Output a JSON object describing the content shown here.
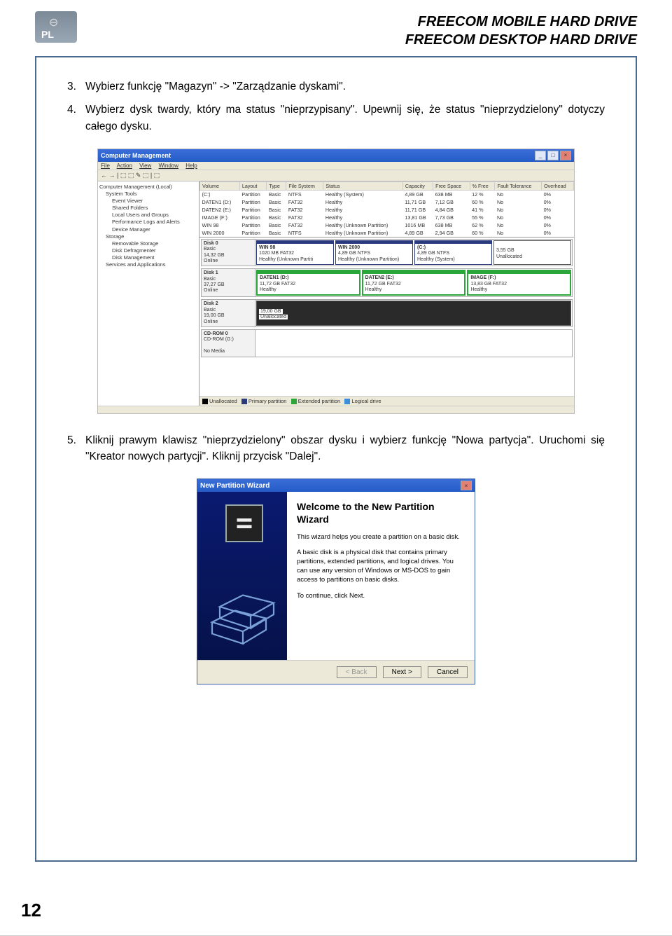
{
  "pl_badge": "PL",
  "header": {
    "line1": "FREECOM MOBILE HARD DRIVE",
    "line2": "FREECOM DESKTOP HARD DRIVE"
  },
  "steps": {
    "s3_num": "3.",
    "s3": "Wybierz funkcję \"Magazyn\" -> \"Zarządzanie dyskami\".",
    "s4_num": "4.",
    "s4": "Wybierz dysk twardy, który ma status \"nieprzypisany\". Upewnij się, że status \"nieprzydzielony\" dotyczy całego dysku.",
    "s5_num": "5.",
    "s5": "Kliknij prawym klawisz \"nieprzydzielony\" obszar dysku i wybierz funkcję \"Nowa partycja\". Uruchomi się \"Kreator nowych partycji\". Kliknij przycisk \"Dalej\"."
  },
  "cm": {
    "title": "Computer Management",
    "menu": {
      "file": "File",
      "action": "Action",
      "view": "View",
      "window": "Window",
      "help": "Help"
    },
    "tree": {
      "root": "Computer Management (Local)",
      "systools": "System Tools",
      "eventviewer": "Event Viewer",
      "sharedfolders": "Shared Folders",
      "localusers": "Local Users and Groups",
      "perflogs": "Performance Logs and Alerts",
      "devicemgr": "Device Manager",
      "storage": "Storage",
      "removable": "Removable Storage",
      "defrag": "Disk Defragmenter",
      "diskmgmt": "Disk Management",
      "services": "Services and Applications"
    },
    "headers": {
      "volume": "Volume",
      "layout": "Layout",
      "type": "Type",
      "fs": "File System",
      "status": "Status",
      "capacity": "Capacity",
      "free": "Free Space",
      "pct": "% Free",
      "fault": "Fault Tolerance",
      "over": "Overhead"
    },
    "vols": [
      {
        "v": "(C:)",
        "l": "Partition",
        "t": "Basic",
        "f": "NTFS",
        "s": "Healthy (System)",
        "c": "4,89 GB",
        "fr": "638 MB",
        "p": "12 %",
        "ft": "No",
        "o": "0%"
      },
      {
        "v": "DATEN1 (D:)",
        "l": "Partition",
        "t": "Basic",
        "f": "FAT32",
        "s": "Healthy",
        "c": "11,71 GB",
        "fr": "7,12 GB",
        "p": "60 %",
        "ft": "No",
        "o": "0%"
      },
      {
        "v": "DATEN2 (E:)",
        "l": "Partition",
        "t": "Basic",
        "f": "FAT32",
        "s": "Healthy",
        "c": "11,71 GB",
        "fr": "4,84 GB",
        "p": "41 %",
        "ft": "No",
        "o": "0%"
      },
      {
        "v": "IMAGE (F:)",
        "l": "Partition",
        "t": "Basic",
        "f": "FAT32",
        "s": "Healthy",
        "c": "13,81 GB",
        "fr": "7,73 GB",
        "p": "55 %",
        "ft": "No",
        "o": "0%"
      },
      {
        "v": "WIN 98",
        "l": "Partition",
        "t": "Basic",
        "f": "FAT32",
        "s": "Healthy (Unknown Partition)",
        "c": "1016 MB",
        "fr": "638 MB",
        "p": "62 %",
        "ft": "No",
        "o": "0%"
      },
      {
        "v": "WIN 2000",
        "l": "Partition",
        "t": "Basic",
        "f": "NTFS",
        "s": "Healthy (Unknown Partition)",
        "c": "4,89 GB",
        "fr": "2,94 GB",
        "p": "60 %",
        "ft": "No",
        "o": "0%"
      }
    ],
    "disks": {
      "d0": {
        "label": "Disk 0",
        "type": "Basic",
        "size": "14,32 GB",
        "state": "Online",
        "p1": {
          "n": "WIN 98",
          "d": "1020 MB FAT32",
          "s": "Healthy (Unknown Partiti"
        },
        "p2": {
          "n": "WIN 2000",
          "d": "4,89 GB NTFS",
          "s": "Healthy (Unknown Partition)"
        },
        "p3": {
          "n": "(C:)",
          "d": "4,89 GB NTFS",
          "s": "Healthy (System)"
        },
        "p4": {
          "n": "",
          "d": "3,55 GB",
          "s": "Unallocated"
        }
      },
      "d1": {
        "label": "Disk 1",
        "type": "Basic",
        "size": "37,27 GB",
        "state": "Online",
        "p1": {
          "n": "DATEN1 (D:)",
          "d": "11,72 GB FAT32",
          "s": "Healthy"
        },
        "p2": {
          "n": "DATEN2 (E:)",
          "d": "11,72 GB FAT32",
          "s": "Healthy"
        },
        "p3": {
          "n": "IMAGE (F:)",
          "d": "13,83 GB FAT32",
          "s": "Healthy"
        }
      },
      "d2": {
        "label": "Disk 2",
        "type": "Basic",
        "size": "19,00 GB",
        "state": "Online",
        "p1": {
          "n": "",
          "d": "19,00 GB",
          "s": "Unallocated"
        }
      },
      "cd": {
        "label": "CD-ROM 0",
        "type": "CD-ROM (G:)",
        "state": "No Media"
      }
    },
    "legend": {
      "un": "Unallocated",
      "pp": "Primary partition",
      "ep": "Extended partition",
      "ld": "Logical drive"
    }
  },
  "wizard": {
    "title": "New Partition Wizard",
    "heading": "Welcome to the New Partition Wizard",
    "p1": "This wizard helps you create a partition on a basic disk.",
    "p2": "A basic disk is a physical disk that contains primary partitions, extended partitions, and logical drives. You can use any version of Windows or MS-DOS to gain access to partitions on basic disks.",
    "p3": "To continue, click Next.",
    "back": "< Back",
    "next": "Next >",
    "cancel": "Cancel"
  },
  "page_number": "12"
}
